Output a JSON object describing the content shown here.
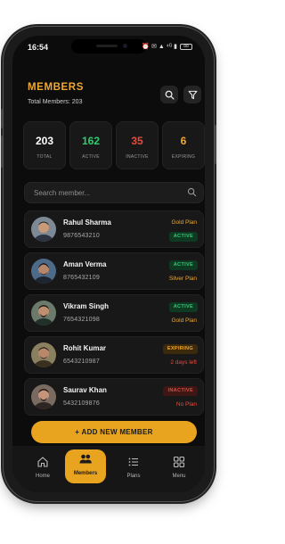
{
  "status_bar": {
    "time": "16:54",
    "icons": "⏰ ✉ ▲ ⁴ᴳ ▮",
    "battery": "88"
  },
  "header": {
    "title": "MEMBERS",
    "subtitle": "Total Members: 203"
  },
  "stats": [
    {
      "value": "203",
      "label": "TOTAL",
      "color": "#ffffff"
    },
    {
      "value": "162",
      "label": "ACTIVE",
      "color": "#2ecc71"
    },
    {
      "value": "35",
      "label": "INACTIVE",
      "color": "#e74c3c"
    },
    {
      "value": "6",
      "label": "EXPIRING",
      "color": "#f0a830"
    }
  ],
  "search": {
    "placeholder": "Search member..."
  },
  "members": [
    {
      "name": "Rahul Sharma",
      "phone": "9876543210",
      "top": "Gold Plan",
      "bottom": "ACTIVE"
    },
    {
      "name": "Aman Verma",
      "phone": "8765432109",
      "top": "ACTIVE",
      "bottom": "Silver Plan"
    },
    {
      "name": "Vikram Singh",
      "phone": "7654321098",
      "top": "ACTIVE",
      "bottom": "Gold Plan"
    },
    {
      "name": "Rohit Kumar",
      "phone": "6543210987",
      "top": "EXPIRING",
      "bottom": "2 days left"
    },
    {
      "name": "Saurav Khan",
      "phone": "5432109876",
      "top": "INACTIVE",
      "bottom": "No Plan"
    }
  ],
  "add_button": {
    "label": "+ ADD NEW MEMBER"
  },
  "nav": [
    {
      "label": "Home",
      "icon": "home-icon"
    },
    {
      "label": "Members",
      "icon": "users-icon",
      "active": true
    },
    {
      "label": "Plans",
      "icon": "list-icon"
    },
    {
      "label": "Menu",
      "icon": "grid-icon"
    }
  ],
  "colors": {
    "accent": "#e8a41f",
    "active": "#2ecc71",
    "inactive": "#e74c3c",
    "expiring": "#f0a830",
    "background": "#0c0c0c"
  }
}
